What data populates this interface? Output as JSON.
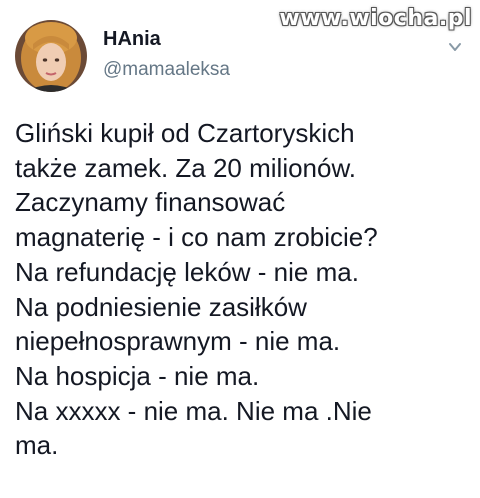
{
  "watermark": "www.wiocha.pl",
  "author": {
    "display_name": "HAnia",
    "handle": "@mamaaleksa",
    "avatar_icon": "profile-photo"
  },
  "menu_icon": "chevron-down-icon",
  "tweet": {
    "lines": [
      "Gliński kupił od Czartoryskich",
      "także zamek. Za 20 milionów.",
      "Zaczynamy finansować",
      "magnaterię - i co nam zrobicie?",
      "Na refundację leków - nie ma.",
      "Na podniesienie zasiłków",
      "niepełnosprawnym - nie ma.",
      "Na hospicja - nie ma.",
      "Na xxxxx - nie ma. Nie ma .Nie",
      "ma."
    ]
  },
  "colors": {
    "text": "#141823",
    "handle": "#657786"
  }
}
